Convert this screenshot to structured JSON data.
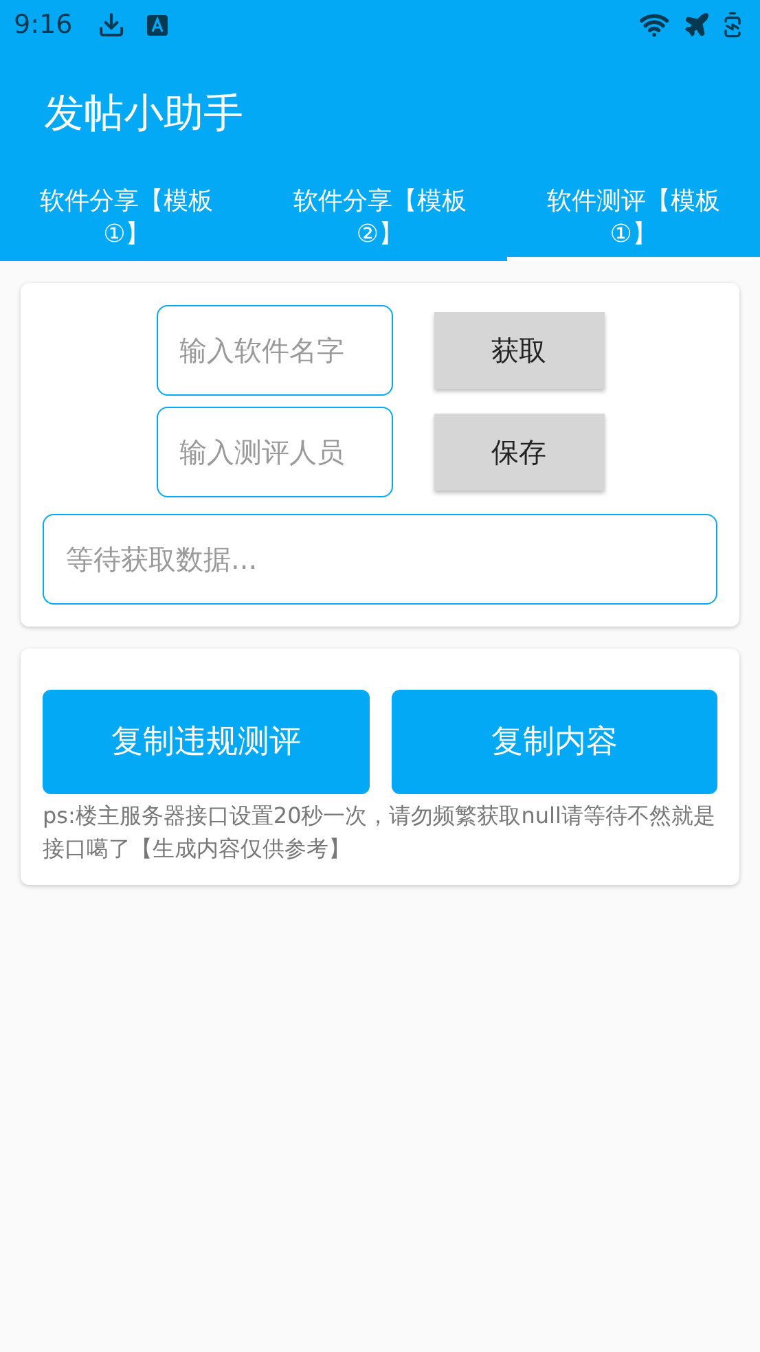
{
  "status_bar": {
    "time": "9:16"
  },
  "app_bar": {
    "title": "发帖小助手"
  },
  "tabs": [
    {
      "label": "软件分享【模板①】",
      "selected": false
    },
    {
      "label": "软件分享【模板②】",
      "selected": false
    },
    {
      "label": "软件测评【模板①】",
      "selected": true
    }
  ],
  "form": {
    "fields": [
      {
        "placeholder": "输入软件名字",
        "button": "获取"
      },
      {
        "placeholder": "输入测评人员",
        "button": "保存"
      }
    ],
    "output": {
      "placeholder": "等待获取数据..."
    }
  },
  "actions": {
    "buttons": [
      "复制违规测评",
      "复制内容"
    ],
    "note": "ps:楼主服务器接口设置20秒一次，请勿频繁获取null请等待不然就是接口噶了【生成内容仅供参考】"
  }
}
